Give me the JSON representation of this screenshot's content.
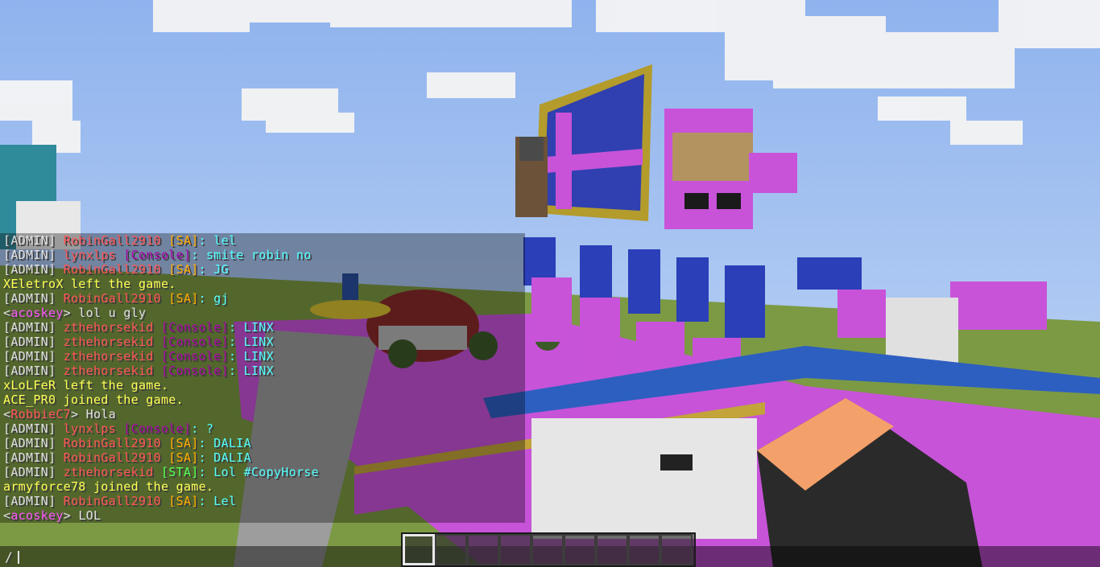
{
  "colors": {
    "sky": "#b3cdf2",
    "cloud": "#f2f2f2",
    "pink": "#c853d9",
    "blue": "#2a3fb8",
    "gold": "#b39b2c",
    "grass": "#7a9a3a",
    "arm_sleeve": "#f49b66",
    "arm_dark": "#2a2a2a"
  },
  "chat": {
    "lines": [
      [
        {
          "t": "[ADMIN] ",
          "c": "#e0e0e0"
        },
        {
          "t": "RobinGall2910",
          "c": "#ff5555"
        },
        {
          "t": " [SA]",
          "c": "#ffaa00"
        },
        {
          "t": ": lel",
          "c": "#55ffff"
        }
      ],
      [
        {
          "t": "[ADMIN] ",
          "c": "#e0e0e0"
        },
        {
          "t": "lynxlps",
          "c": "#ff5555"
        },
        {
          "t": " [Console]",
          "c": "#aa00aa"
        },
        {
          "t": ": smite robin no",
          "c": "#55ffff"
        }
      ],
      [
        {
          "t": "[ADMIN] ",
          "c": "#e0e0e0"
        },
        {
          "t": "RobinGall2910",
          "c": "#ff5555"
        },
        {
          "t": " [SA]",
          "c": "#ffaa00"
        },
        {
          "t": ": JG",
          "c": "#55ffff"
        }
      ],
      [
        {
          "t": "XEletroX left the game.",
          "c": "#ffff55"
        }
      ],
      [
        {
          "t": "[ADMIN] ",
          "c": "#e0e0e0"
        },
        {
          "t": "RobinGall2910",
          "c": "#ff5555"
        },
        {
          "t": " [SA]",
          "c": "#ffaa00"
        },
        {
          "t": ": gj",
          "c": "#55ffff"
        }
      ],
      [
        {
          "t": "<",
          "c": "#e0e0e0"
        },
        {
          "t": "acoskey",
          "c": "#ff55ff"
        },
        {
          "t": "> lol u gly",
          "c": "#e0e0e0"
        }
      ],
      [
        {
          "t": "[ADMIN] ",
          "c": "#e0e0e0"
        },
        {
          "t": "zthehorsekid",
          "c": "#ff5555"
        },
        {
          "t": " [Console]",
          "c": "#aa00aa"
        },
        {
          "t": ": LINX",
          "c": "#55ffff"
        }
      ],
      [
        {
          "t": "[ADMIN] ",
          "c": "#e0e0e0"
        },
        {
          "t": "zthehorsekid",
          "c": "#ff5555"
        },
        {
          "t": " [Console]",
          "c": "#aa00aa"
        },
        {
          "t": ": LINX",
          "c": "#55ffff"
        }
      ],
      [
        {
          "t": "[ADMIN] ",
          "c": "#e0e0e0"
        },
        {
          "t": "zthehorsekid",
          "c": "#ff5555"
        },
        {
          "t": " [Console]",
          "c": "#aa00aa"
        },
        {
          "t": ": LINX",
          "c": "#55ffff"
        }
      ],
      [
        {
          "t": "[ADMIN] ",
          "c": "#e0e0e0"
        },
        {
          "t": "zthehorsekid",
          "c": "#ff5555"
        },
        {
          "t": " [Console]",
          "c": "#aa00aa"
        },
        {
          "t": ": LINX",
          "c": "#55ffff"
        }
      ],
      [
        {
          "t": "xLoLFeR left the game.",
          "c": "#ffff55"
        }
      ],
      [
        {
          "t": "ACE_PR0 joined the game.",
          "c": "#ffff55"
        }
      ],
      [
        {
          "t": "<",
          "c": "#e0e0e0"
        },
        {
          "t": "RobbieC7",
          "c": "#ff5555"
        },
        {
          "t": "> Hola",
          "c": "#e0e0e0"
        }
      ],
      [
        {
          "t": "[ADMIN] ",
          "c": "#e0e0e0"
        },
        {
          "t": "lynxlps",
          "c": "#ff5555"
        },
        {
          "t": " [Console]",
          "c": "#aa00aa"
        },
        {
          "t": ": ?",
          "c": "#55ffff"
        }
      ],
      [
        {
          "t": "[ADMIN] ",
          "c": "#e0e0e0"
        },
        {
          "t": "RobinGall2910",
          "c": "#ff5555"
        },
        {
          "t": " [SA]",
          "c": "#ffaa00"
        },
        {
          "t": ": DALIA",
          "c": "#55ffff"
        }
      ],
      [
        {
          "t": "[ADMIN] ",
          "c": "#e0e0e0"
        },
        {
          "t": "RobinGall2910",
          "c": "#ff5555"
        },
        {
          "t": " [SA]",
          "c": "#ffaa00"
        },
        {
          "t": ": DALIA",
          "c": "#55ffff"
        }
      ],
      [
        {
          "t": "[ADMIN] ",
          "c": "#e0e0e0"
        },
        {
          "t": "zthehorsekid",
          "c": "#ff5555"
        },
        {
          "t": " [STA]",
          "c": "#55ff55"
        },
        {
          "t": ": Lol #CopyHorse",
          "c": "#55ffff"
        }
      ],
      [
        {
          "t": "armyforce78 joined the game.",
          "c": "#ffff55"
        }
      ],
      [
        {
          "t": "[ADMIN] ",
          "c": "#e0e0e0"
        },
        {
          "t": "RobinGall2910",
          "c": "#ff5555"
        },
        {
          "t": " [SA]",
          "c": "#ffaa00"
        },
        {
          "t": ": Lel",
          "c": "#55ffff"
        }
      ],
      [
        {
          "t": "<",
          "c": "#e0e0e0"
        },
        {
          "t": "acoskey",
          "c": "#ff55ff"
        },
        {
          "t": "> LOL",
          "c": "#e0e0e0"
        }
      ]
    ],
    "input_value": "/"
  },
  "hotbar": {
    "slot_count": 9,
    "selected_index": 0
  }
}
